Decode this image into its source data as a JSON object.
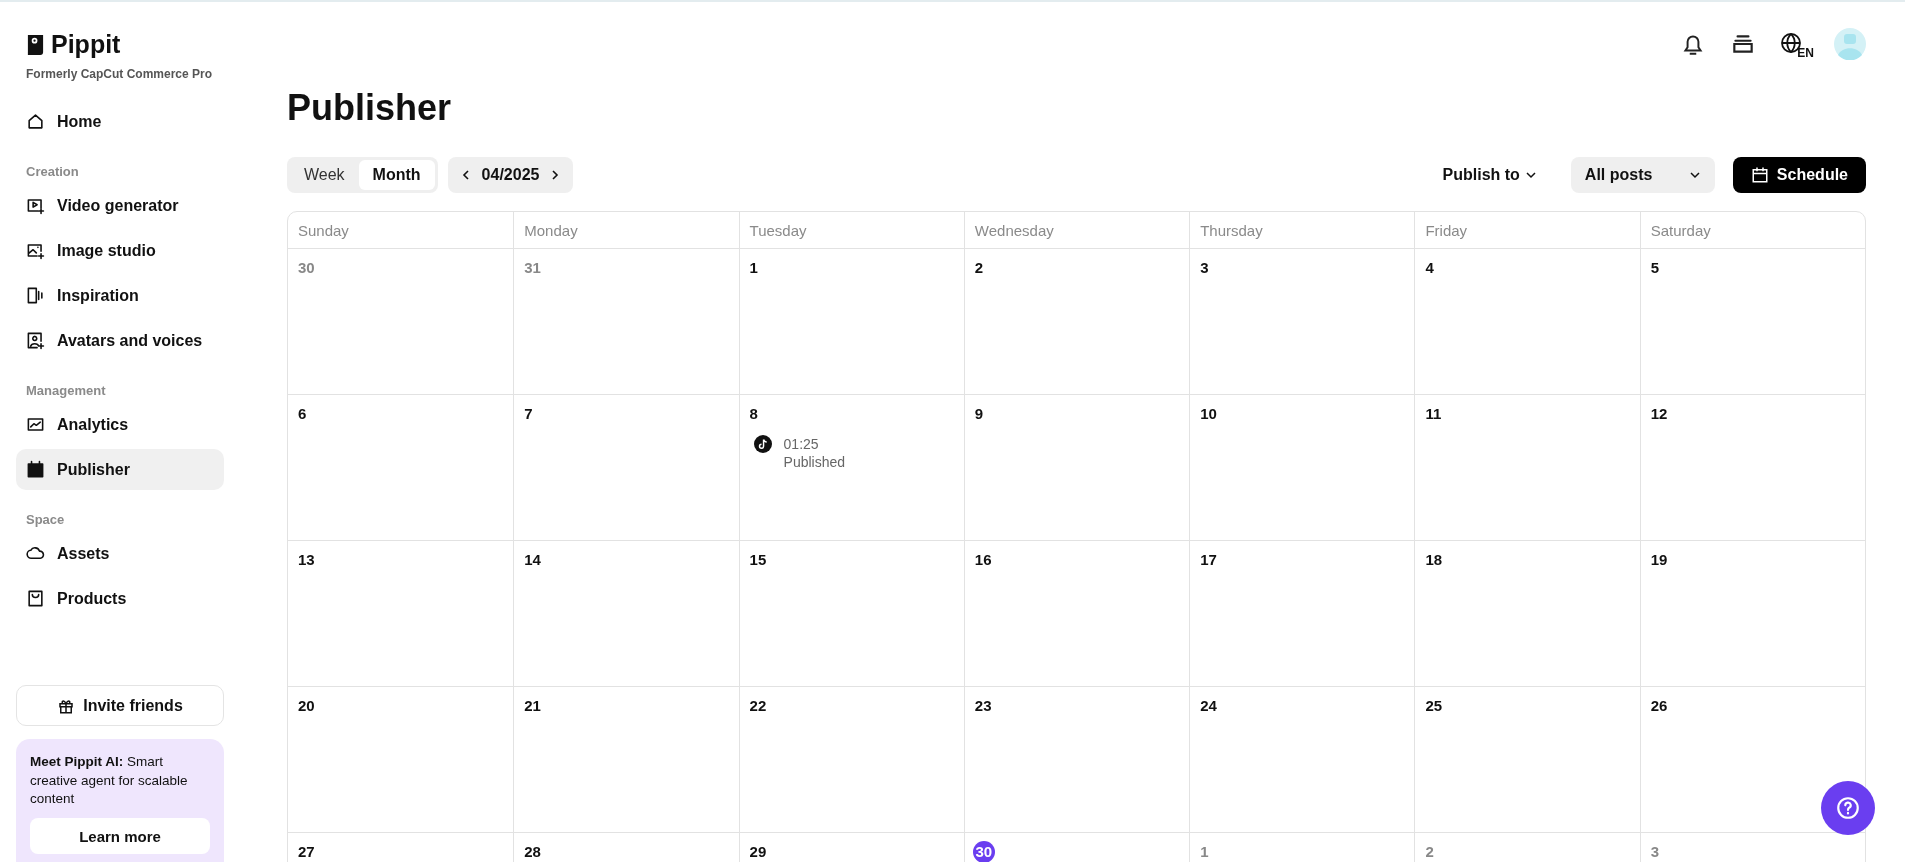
{
  "brand": {
    "name": "Pippit",
    "subtitle": "Formerly CapCut Commerce Pro"
  },
  "sidebar": {
    "sections": [
      {
        "items": [
          {
            "label": "Home",
            "selected": false
          }
        ]
      },
      {
        "heading": "Creation",
        "items": [
          {
            "label": "Video generator",
            "selected": false
          },
          {
            "label": "Image studio",
            "selected": false
          },
          {
            "label": "Inspiration",
            "selected": false
          },
          {
            "label": "Avatars and voices",
            "selected": false
          }
        ]
      },
      {
        "heading": "Management",
        "items": [
          {
            "label": "Analytics",
            "selected": false
          },
          {
            "label": "Publisher",
            "selected": true
          }
        ]
      },
      {
        "heading": "Space",
        "items": [
          {
            "label": "Assets",
            "selected": false
          },
          {
            "label": "Products",
            "selected": false
          }
        ]
      }
    ],
    "invite_button": "Invite friends",
    "promo": {
      "text": "**Meet Pippit AI:** Smart creative agent for scalable content",
      "button": "Learn more"
    }
  },
  "header": {
    "language": "EN"
  },
  "page_title": "Publisher",
  "toolbar": {
    "views": [
      {
        "label": "Week",
        "selected": false
      },
      {
        "label": "Month",
        "selected": true
      }
    ],
    "period": "04/2025",
    "publish_to": "Publish to",
    "filter": "All posts",
    "schedule_button": "Schedule"
  },
  "calendar": {
    "columns": [
      "Sunday",
      "Monday",
      "Tuesday",
      "Wednesday",
      "Thursday",
      "Friday",
      "Saturday"
    ],
    "weeks": [
      [
        {
          "label": "30",
          "in_month": false,
          "today": false
        },
        {
          "label": "31",
          "in_month": false,
          "today": false
        },
        {
          "label": "1",
          "in_month": true,
          "today": false
        },
        {
          "label": "2",
          "in_month": true,
          "today": false
        },
        {
          "label": "3",
          "in_month": true,
          "today": false
        },
        {
          "label": "4",
          "in_month": true,
          "today": false
        },
        {
          "label": "5",
          "in_month": true,
          "today": false
        }
      ],
      [
        {
          "label": "6",
          "in_month": true,
          "today": false
        },
        {
          "label": "7",
          "in_month": true,
          "today": false
        },
        {
          "label": "8",
          "in_month": true,
          "today": false,
          "events": [
            {
              "time": "01:25",
              "status": "Published"
            }
          ]
        },
        {
          "label": "9",
          "in_month": true,
          "today": false
        },
        {
          "label": "10",
          "in_month": true,
          "today": false
        },
        {
          "label": "11",
          "in_month": true,
          "today": false
        },
        {
          "label": "12",
          "in_month": true,
          "today": false
        }
      ],
      [
        {
          "label": "13",
          "in_month": true,
          "today": false
        },
        {
          "label": "14",
          "in_month": true,
          "today": false
        },
        {
          "label": "15",
          "in_month": true,
          "today": false
        },
        {
          "label": "16",
          "in_month": true,
          "today": false
        },
        {
          "label": "17",
          "in_month": true,
          "today": false
        },
        {
          "label": "18",
          "in_month": true,
          "today": false
        },
        {
          "label": "19",
          "in_month": true,
          "today": false
        }
      ],
      [
        {
          "label": "20",
          "in_month": true,
          "today": false
        },
        {
          "label": "21",
          "in_month": true,
          "today": false
        },
        {
          "label": "22",
          "in_month": true,
          "today": false
        },
        {
          "label": "23",
          "in_month": true,
          "today": false
        },
        {
          "label": "24",
          "in_month": true,
          "today": false
        },
        {
          "label": "25",
          "in_month": true,
          "today": false
        },
        {
          "label": "26",
          "in_month": true,
          "today": false
        }
      ],
      [
        {
          "label": "27",
          "in_month": true,
          "today": false
        },
        {
          "label": "28",
          "in_month": true,
          "today": false
        },
        {
          "label": "29",
          "in_month": true,
          "today": false
        },
        {
          "label": "30",
          "in_month": true,
          "today": true
        },
        {
          "label": "1",
          "in_month": false,
          "today": false
        },
        {
          "label": "2",
          "in_month": false,
          "today": false
        },
        {
          "label": "3",
          "in_month": false,
          "today": false
        }
      ]
    ]
  }
}
